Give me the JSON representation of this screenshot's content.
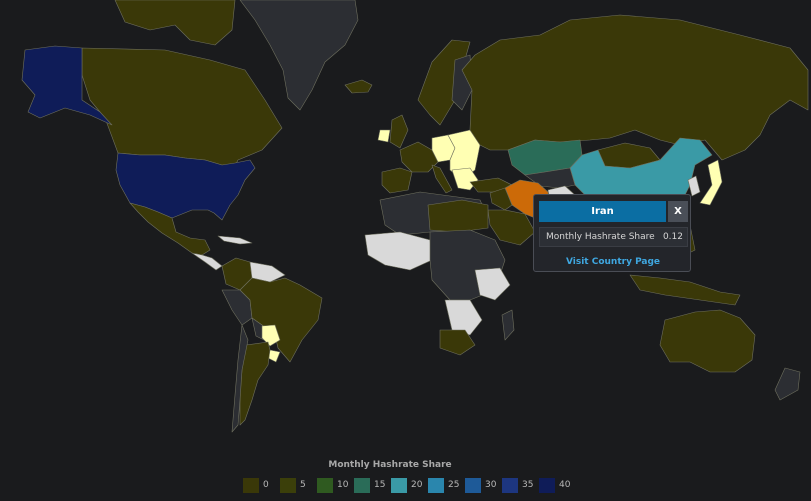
{
  "popup": {
    "country": "Iran",
    "close_label": "X",
    "metric_label": "Monthly Hashrate Share",
    "metric_value": "0.12",
    "link_label": "Visit Country Page"
  },
  "legend": {
    "title": "Monthly Hashrate Share",
    "items": [
      {
        "label": "0",
        "color": "#3a3808"
      },
      {
        "label": "5",
        "color": "#3b3f0a"
      },
      {
        "label": "10",
        "color": "#2f5a20"
      },
      {
        "label": "15",
        "color": "#2a6c58"
      },
      {
        "label": "20",
        "color": "#3a9aa6"
      },
      {
        "label": "25",
        "color": "#2a86ad"
      },
      {
        "label": "30",
        "color": "#1e5a98"
      },
      {
        "label": "35",
        "color": "#1d3680"
      },
      {
        "label": "40",
        "color": "#0f1c58"
      }
    ]
  },
  "colors": {
    "ocean": "#1a1b1d",
    "no_data": "#d9d9d9",
    "minor": "#ffffb3",
    "gray_land": "#2c2e33",
    "low": "#3a3808",
    "usa": "#0f1c58",
    "iran": "#cc6a08",
    "kazakhstan": "#2a6c58",
    "china": "#3a9aa6",
    "border": "#7a7a70"
  }
}
